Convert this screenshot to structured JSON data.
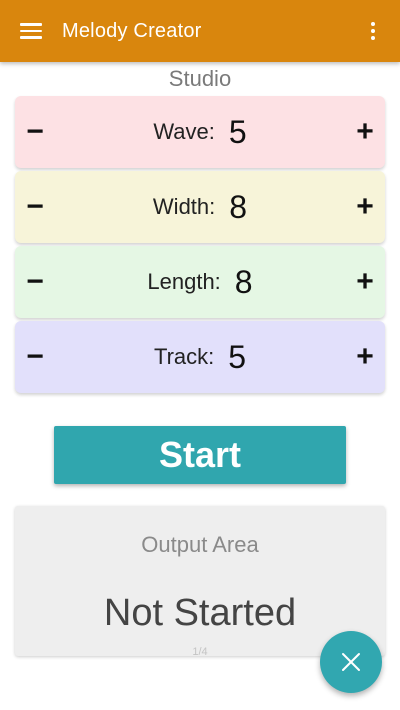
{
  "colors": {
    "appbar": "#d9860d",
    "wave_bg": "#fde1e4",
    "width_bg": "#f7f4d9",
    "length_bg": "#e5f7e4",
    "track_bg": "#e2e0fb",
    "start_bg": "#30a6ae",
    "fab_bg": "#31a7b0"
  },
  "appbar": {
    "title": "Melody Creator",
    "menu_icon": "hamburger-menu-icon",
    "overflow_icon": "more-vert-icon"
  },
  "studio": {
    "label": "Studio"
  },
  "controls": [
    {
      "id": "wave",
      "label": "Wave:",
      "value": "5",
      "minus": "−",
      "plus": "+"
    },
    {
      "id": "width",
      "label": "Width:",
      "value": "8",
      "minus": "−",
      "plus": "+"
    },
    {
      "id": "length",
      "label": "Length:",
      "value": "8",
      "minus": "−",
      "plus": "+"
    },
    {
      "id": "track",
      "label": "Track:",
      "value": "5",
      "minus": "−",
      "plus": "+"
    }
  ],
  "start_button": {
    "label": "Start"
  },
  "output": {
    "title": "Output Area",
    "status": "Not Started",
    "page_indicator": "1/4"
  },
  "fab": {
    "icon": "close-icon"
  }
}
